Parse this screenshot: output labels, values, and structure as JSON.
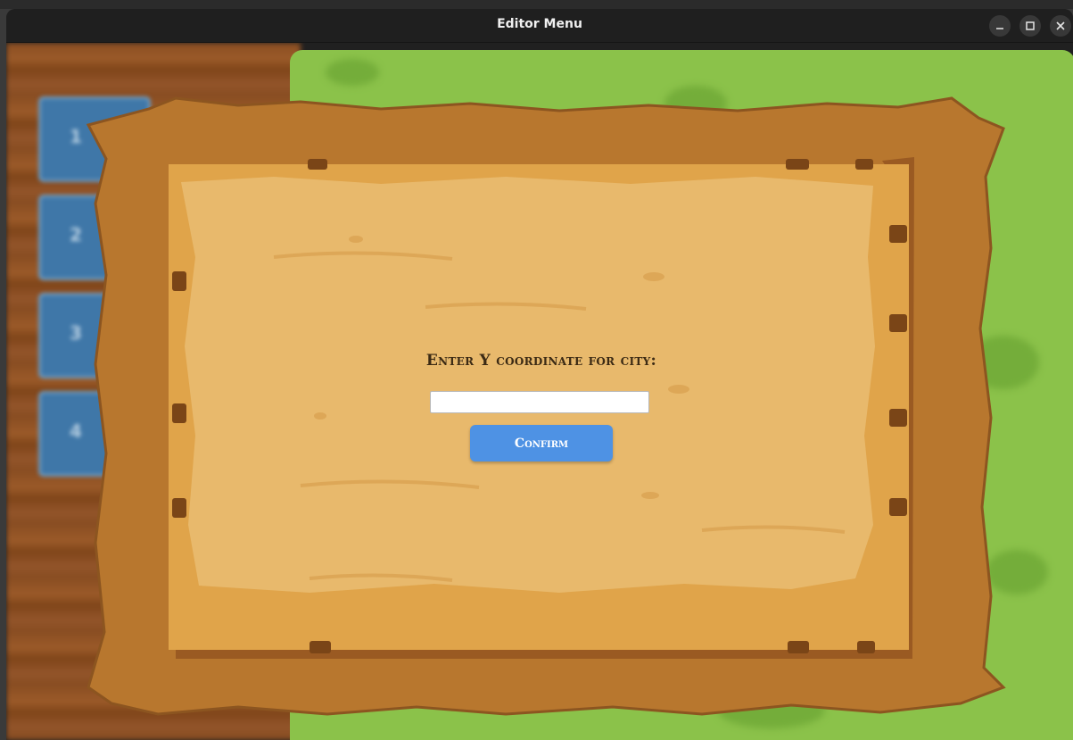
{
  "window": {
    "title": "Editor Menu",
    "controls": {
      "minimize": "minimize-icon",
      "maximize": "maximize-icon",
      "close": "close-icon"
    }
  },
  "background": {
    "level_tabs": [
      "1",
      "2",
      "3",
      "4"
    ]
  },
  "dialog": {
    "prompt": "Enter Y coordinate for city:",
    "input_value": "",
    "input_placeholder": "",
    "confirm_label": "Confirm"
  },
  "colors": {
    "titlebar": "#1f1f1f",
    "grass": "#8bc24a",
    "wood": "#8a4e22",
    "frame": "#b8772e",
    "parchment": "#e4b56a",
    "button": "#4e92e4",
    "label": "#3b2a14"
  }
}
